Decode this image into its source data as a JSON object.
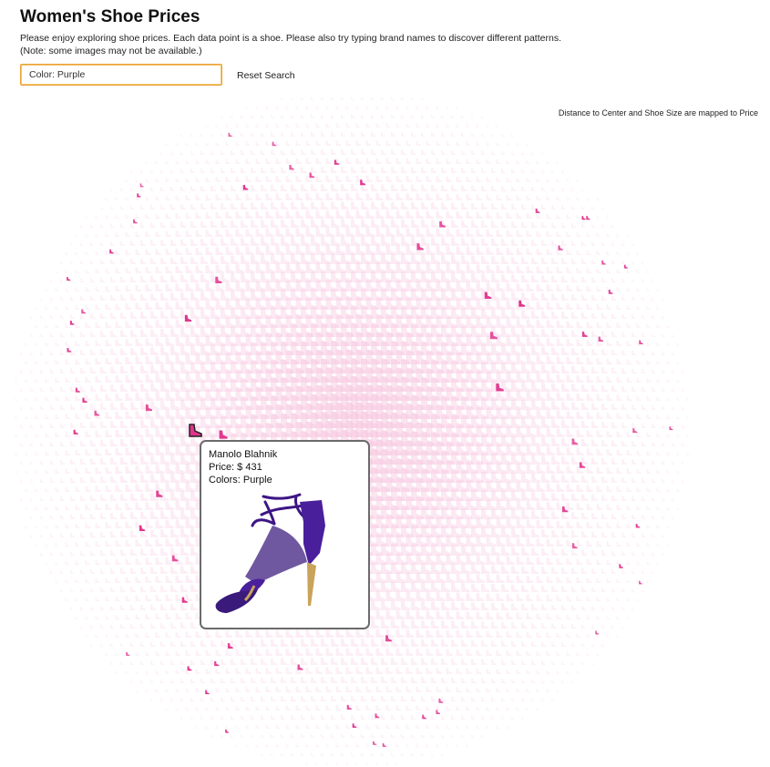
{
  "header": {
    "title": "Women's Shoe Prices",
    "description_line1": "Please enjoy exploring shoe prices. Each data point is a shoe. Please also try typing brand names to discover different patterns.",
    "description_line2": "(Note: some images may not be available.)"
  },
  "search": {
    "value": "Color: Purple",
    "reset_label": "Reset Search"
  },
  "caption": "Distance to Center and Shoe Size are mapped to Price",
  "colors": {
    "mark_faded": "#f7c6df",
    "mark_highlight": "#e0348d",
    "hovered_outline": "#222222",
    "search_border": "#e8a33a",
    "shoe_purple": "#4a1f9c"
  },
  "tooltip": {
    "brand": "Manolo Blahnik",
    "price_text": "Price: $ 431",
    "colors_text": "Colors: Purple"
  },
  "chart_data": {
    "type": "scatter",
    "encoding": "radial",
    "mark": "shoe-shaped glyph",
    "radius_and_size_encode": "price",
    "highlight_filter": "Color: Purple",
    "hovered_point": {
      "brand": "Manolo Blahnik",
      "price": 431,
      "colors": "Purple"
    }
  }
}
